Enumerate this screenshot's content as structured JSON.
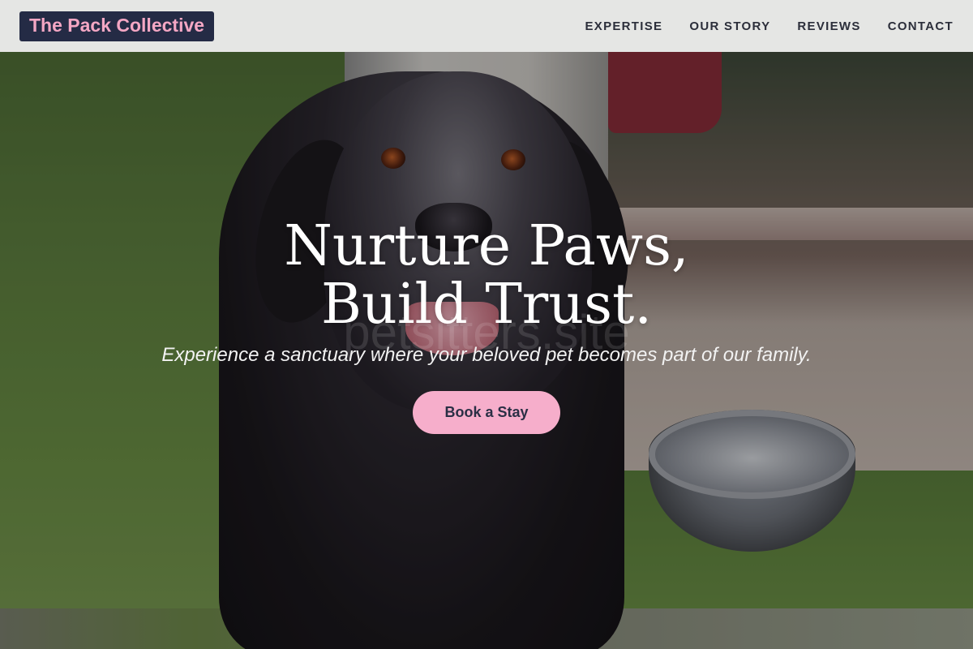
{
  "header": {
    "brand": "The Pack Collective",
    "nav": [
      {
        "label": "EXPERTISE"
      },
      {
        "label": "OUR STORY"
      },
      {
        "label": "REVIEWS"
      },
      {
        "label": "CONTACT"
      }
    ]
  },
  "hero": {
    "headline": "Nurture Paws, Build Trust.",
    "watermark": "petsitters.site",
    "tagline": "Experience a sanctuary where your beloved pet becomes part of our family.",
    "cta_label": "Book a Stay"
  },
  "colors": {
    "brand_bg": "#242b45",
    "brand_text": "#f4a7c4",
    "cta_bg": "#f6aecb",
    "cta_text": "#2a2f45",
    "header_bg": "#f0f0f0"
  }
}
